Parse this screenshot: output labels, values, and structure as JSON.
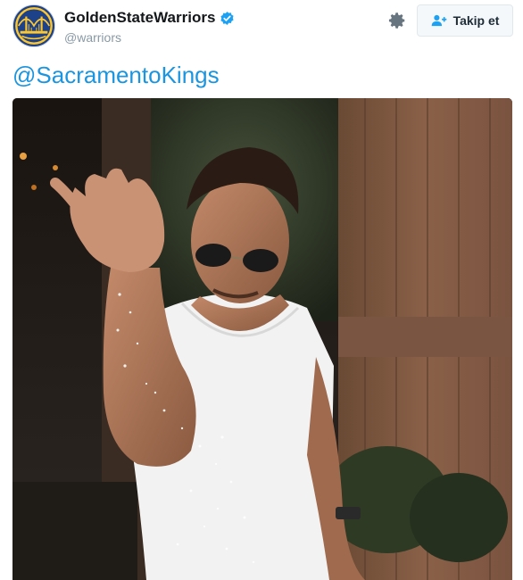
{
  "account": {
    "display_name": "GoldenStateWarriors",
    "handle": "@warriors",
    "verified": true,
    "avatar_icon": "warriors-bridge-logo",
    "avatar_colors": {
      "primary": "#1d428a",
      "secondary": "#ffc72c"
    }
  },
  "actions": {
    "settings_icon": "gear-icon",
    "follow_label": "Takip et",
    "follow_icon": "add-user-icon"
  },
  "tweet": {
    "text": "@SacramentoKings"
  },
  "media": {
    "type": "image"
  },
  "colors": {
    "link": "#1b95e0",
    "verified": "#1da1f2",
    "muted": "#8899a6"
  }
}
